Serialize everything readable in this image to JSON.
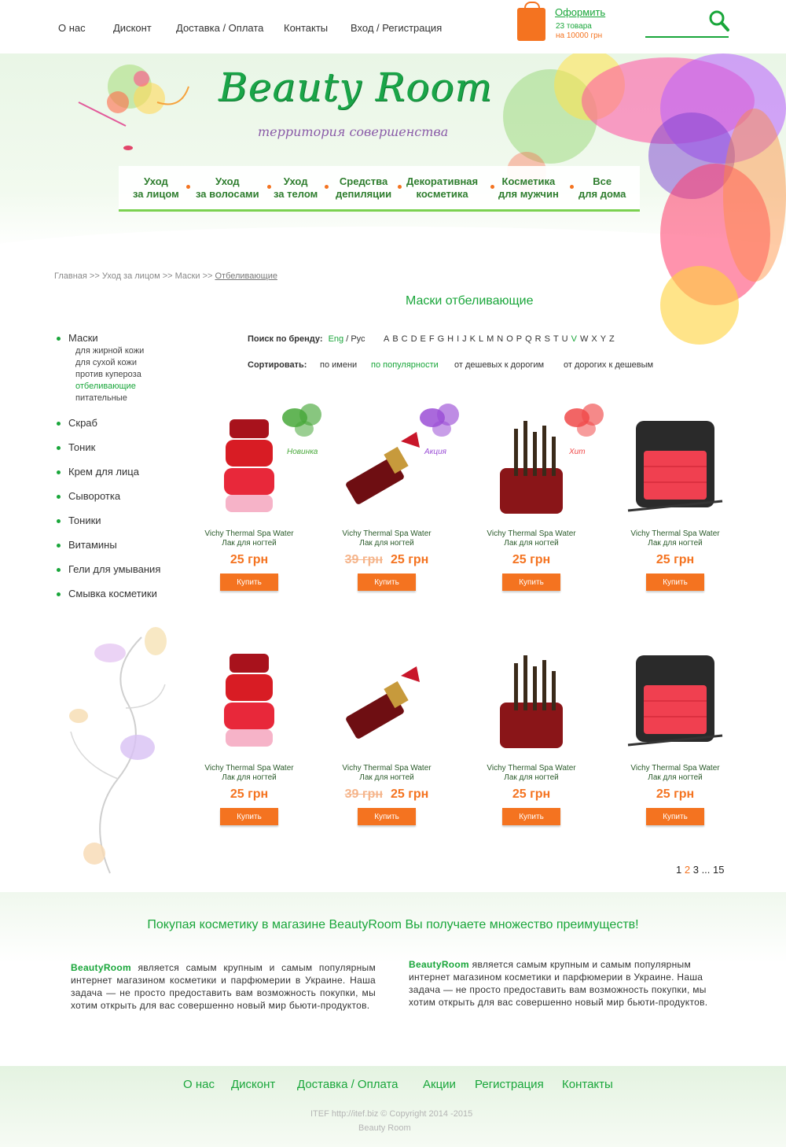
{
  "topnav": [
    "О нас",
    "Дисконт",
    "Доставка / Оплата",
    "Контакты",
    "Вход / Регистрация"
  ],
  "cart": {
    "checkout": "Оформить",
    "count": "23 товара",
    "total": "на 10000 грн"
  },
  "header": {
    "logo": "Beauty Room",
    "tagline": "территория совершенства"
  },
  "categories": [
    {
      "l1": "Уход",
      "l2": "за лицом"
    },
    {
      "l1": "Уход",
      "l2": "за волосами"
    },
    {
      "l1": "Уход",
      "l2": "за телом"
    },
    {
      "l1": "Средства",
      "l2": "депиляции"
    },
    {
      "l1": "Декоративная",
      "l2": "косметика"
    },
    {
      "l1": "Косметика",
      "l2": "для мужчин"
    },
    {
      "l1": "Все",
      "l2": "для дома"
    }
  ],
  "breadcrumb": {
    "text": "Главная >> Уход за лицом >> Маски >> ",
    "current": "Отбеливающие"
  },
  "page_title": "Маски отбеливающие",
  "sidebar": {
    "first": "Маски",
    "subs": [
      "для жирной кожи",
      "для сухой кожи",
      "против купероза",
      "отбеливающие",
      "питательные"
    ],
    "active_sub": 3,
    "items": [
      "Скраб",
      "Тоник",
      "Крем для лица",
      "Сыворотка",
      "Тоники",
      "Витамины",
      "Гели для умывания",
      "Смывка косметики"
    ]
  },
  "brand_filter": {
    "label": "Поиск по бренду:",
    "eng": "Eng",
    "sep": " / ",
    "rus": "Рус",
    "letters": "ABCDEFGHIJKLMNOPQRSTU",
    "highlight": "V",
    "letters_after": "WXYZ"
  },
  "sort": {
    "label": "Сортировать:",
    "options": [
      "по имени",
      "по популярности",
      "от дешевых к дорогим",
      "от дорогих к дешевым"
    ],
    "active": 1
  },
  "products": [
    {
      "name": "Vichy Thermal Spa Water",
      "sub": "Лак для ногтей",
      "old": "",
      "price": "25 грн",
      "badge": "Новинка",
      "badge_color": "#48a83a",
      "kind": "polish"
    },
    {
      "name": "Vichy Thermal Spa Water",
      "sub": "Лак для ногтей",
      "old": "39 грн",
      "price": "25 грн",
      "badge": "Акция",
      "badge_color": "#9b4fd6",
      "kind": "lipstick"
    },
    {
      "name": "Vichy Thermal Spa Water",
      "sub": "Лак для ногтей",
      "old": "",
      "price": "25 грн",
      "badge": "Хит",
      "badge_color": "#f04a4a",
      "kind": "brushes"
    },
    {
      "name": "Vichy Thermal Spa Water",
      "sub": "Лак для ногтей",
      "old": "",
      "price": "25 грн",
      "badge": "",
      "badge_color": "",
      "kind": "palette"
    },
    {
      "name": "Vichy Thermal Spa Water",
      "sub": "Лак для ногтей",
      "old": "",
      "price": "25 грн",
      "badge": "",
      "badge_color": "",
      "kind": "polish"
    },
    {
      "name": "Vichy Thermal Spa Water",
      "sub": "Лак для ногтей",
      "old": "39 грн",
      "price": "25 грн",
      "badge": "",
      "badge_color": "",
      "kind": "lipstick"
    },
    {
      "name": "Vichy Thermal Spa Water",
      "sub": "Лак для ногтей",
      "old": "",
      "price": "25 грн",
      "badge": "",
      "badge_color": "",
      "kind": "brushes"
    },
    {
      "name": "Vichy Thermal Spa Water",
      "sub": "Лак для ногтей",
      "old": "",
      "price": "25 грн",
      "badge": "",
      "badge_color": "",
      "kind": "palette"
    }
  ],
  "buy_label": "Купить",
  "pager": {
    "p1": "1",
    "p2": "2",
    "p3": "3",
    "dots": " ... ",
    "last": "15"
  },
  "benefits": {
    "title_a": "Покупая косметику в магазине ",
    "title_brand": "BeautyRoom",
    "title_b": " Вы получаете множество преимуществ!",
    "brand": "BeautyRoom",
    "text": " является самым крупным и самым популярным интернет магазином косметики и парфюмерии в Украине. Наша задача — не просто предоставить вам возможность покупки, мы хотим открыть для вас совершенно новый мир бьюти-продуктов."
  },
  "footer": {
    "nav": [
      "О нас",
      "Дисконт",
      "Доставка / Оплата",
      "Акции",
      "Регистрация",
      "Контакты"
    ],
    "copyright": "ITEF  http://itef.biz   © Copyright 2014 -2015",
    "brand": "Beauty Room"
  },
  "colors": {
    "green": "#19a63a",
    "orange": "#f47320"
  }
}
